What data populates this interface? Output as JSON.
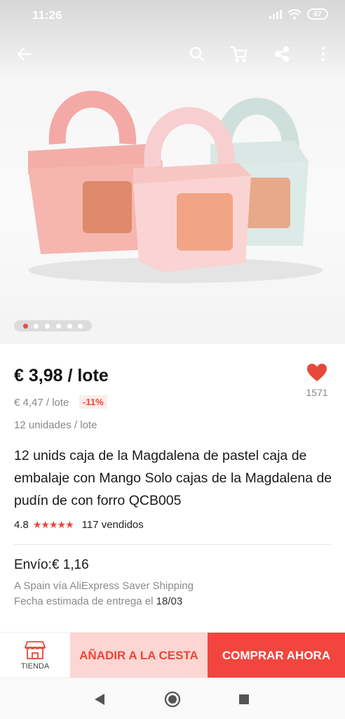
{
  "status_bar": {
    "time": "11:26",
    "battery": "67"
  },
  "topbar": {
    "icons": [
      "back-arrow-icon",
      "search-icon",
      "cart-icon",
      "share-icon",
      "more-vert-icon"
    ]
  },
  "gallery": {
    "dot_count": 6,
    "active_index": 0
  },
  "product": {
    "price": "€ 3,98 / lote",
    "old_price": "€ 4,47 / lote",
    "discount": "-11%",
    "units": "12 unidades / lote",
    "title": "12 unids caja de la Magdalena de pastel caja de embalaje con Mango Solo cajas de la Magdalena de pudín de con forro QCB005",
    "rating": "4.8",
    "stars": "★★★★★",
    "sold": "117 vendidos",
    "wishlist_count": "1571"
  },
  "shipping": {
    "cost": "Envío:€ 1,16",
    "via": "A Spain vía AliExpress Saver Shipping",
    "date_label": "Fecha estimada de entrega el",
    "date": "18/03"
  },
  "actions": {
    "store_label": "TIENDA",
    "add_to_cart": "AÑADIR A LA CESTA",
    "buy_now": "COMPRAR AHORA"
  },
  "colors": {
    "accent": "#f1453d",
    "accent_light": "#fbd6d2",
    "heart": "#e8473b"
  }
}
